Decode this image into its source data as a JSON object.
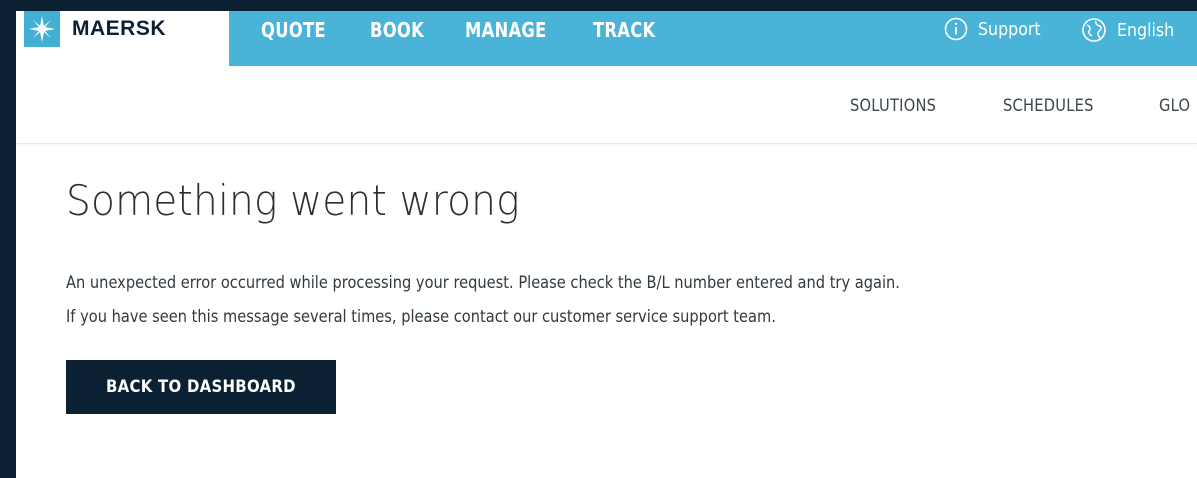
{
  "brand": {
    "name": "MAERSK",
    "color_primary": "#42b0d5",
    "color_dark": "#0b2033"
  },
  "main_nav": [
    {
      "label": "QUOTE"
    },
    {
      "label": "BOOK"
    },
    {
      "label": "MANAGE"
    },
    {
      "label": "TRACK"
    }
  ],
  "utility": {
    "support": {
      "label": "Support",
      "icon": "info-icon"
    },
    "language": {
      "label": "English",
      "icon": "globe-icon"
    }
  },
  "sub_nav": [
    {
      "label": "SOLUTIONS"
    },
    {
      "label": "SCHEDULES"
    },
    {
      "label": "GLO"
    }
  ],
  "error": {
    "title": "Something went wrong",
    "line1": "An unexpected error occurred while processing your request. Please check the B/L number entered and try again.",
    "line2": "If you have seen this message several times, please contact our customer service support team.",
    "button": "BACK TO DASHBOARD"
  }
}
